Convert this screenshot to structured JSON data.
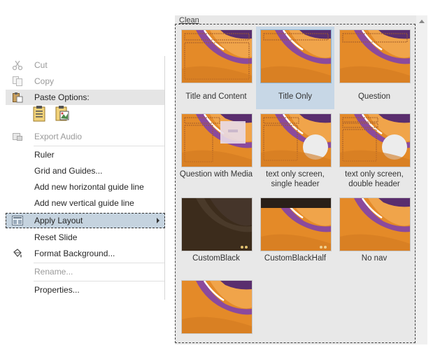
{
  "menu": {
    "items": [
      {
        "label": "Cut",
        "icon": "scissors-icon",
        "disabled": true
      },
      {
        "label": "Copy",
        "icon": "copy-icon",
        "disabled": true
      },
      {
        "label": "Paste Options:",
        "icon": "paste-icon",
        "disabled": false
      },
      {
        "label": "Export Audio",
        "icon": "export-audio-icon",
        "disabled": true
      },
      {
        "label": "Ruler",
        "disabled": false
      },
      {
        "label": "Grid and Guides...",
        "disabled": false
      },
      {
        "label": "Add new horizontal guide line",
        "disabled": false
      },
      {
        "label": "Add new vertical guide line",
        "disabled": false
      },
      {
        "label": "Apply Layout",
        "icon": "layout-icon",
        "disabled": false
      },
      {
        "label": "Reset Slide",
        "disabled": false
      },
      {
        "label": "Format Background...",
        "icon": "format-background-icon",
        "disabled": false
      },
      {
        "label": "Rename...",
        "disabled": true
      },
      {
        "label": "Properties...",
        "disabled": false
      }
    ]
  },
  "gallery": {
    "section_label": "Clean",
    "layouts": [
      {
        "name": "Title and Content",
        "selected": false
      },
      {
        "name": "Title Only",
        "selected": true
      },
      {
        "name": "Question",
        "selected": false
      },
      {
        "name": "Question with Media",
        "selected": false
      },
      {
        "name": "text only screen, single header",
        "selected": false
      },
      {
        "name": "text only screen, double header",
        "selected": false
      },
      {
        "name": "CustomBlack",
        "selected": false
      },
      {
        "name": "CustomBlackHalf",
        "selected": false
      },
      {
        "name": "No nav",
        "selected": false
      },
      {
        "name": "",
        "selected": false
      }
    ]
  },
  "colors": {
    "thumb_orange": "#e48a28",
    "thumb_purple": "#8b4a9c",
    "selected_tile": "#c7d7e6",
    "menu_selected": "#c5d3df"
  }
}
